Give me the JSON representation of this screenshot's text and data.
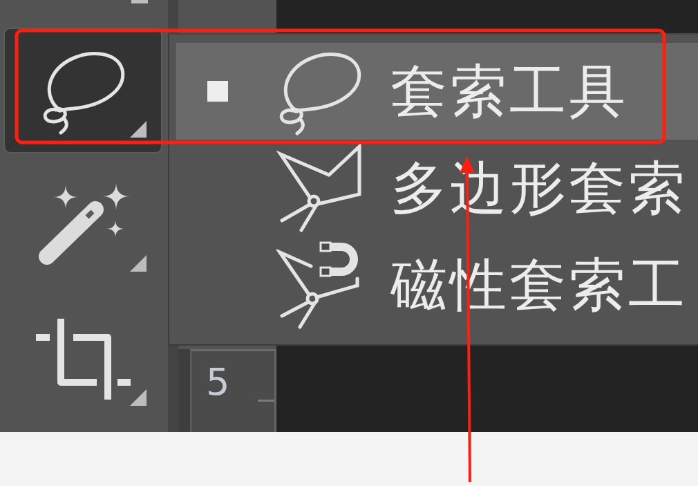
{
  "toolbar": {
    "tools": [
      {
        "kind": "lasso",
        "selected": true
      },
      {
        "kind": "magic-wand",
        "selected": false
      },
      {
        "kind": "crop",
        "selected": false
      }
    ]
  },
  "flyout": {
    "items": [
      {
        "kind": "lasso",
        "label": "套索工具",
        "selected": true
      },
      {
        "kind": "polygonal-lasso",
        "label": "多边形套索",
        "selected": false
      },
      {
        "kind": "magnetic-lasso",
        "label": "磁性套索工",
        "selected": false
      }
    ]
  },
  "ruler": {
    "label": "5"
  }
}
